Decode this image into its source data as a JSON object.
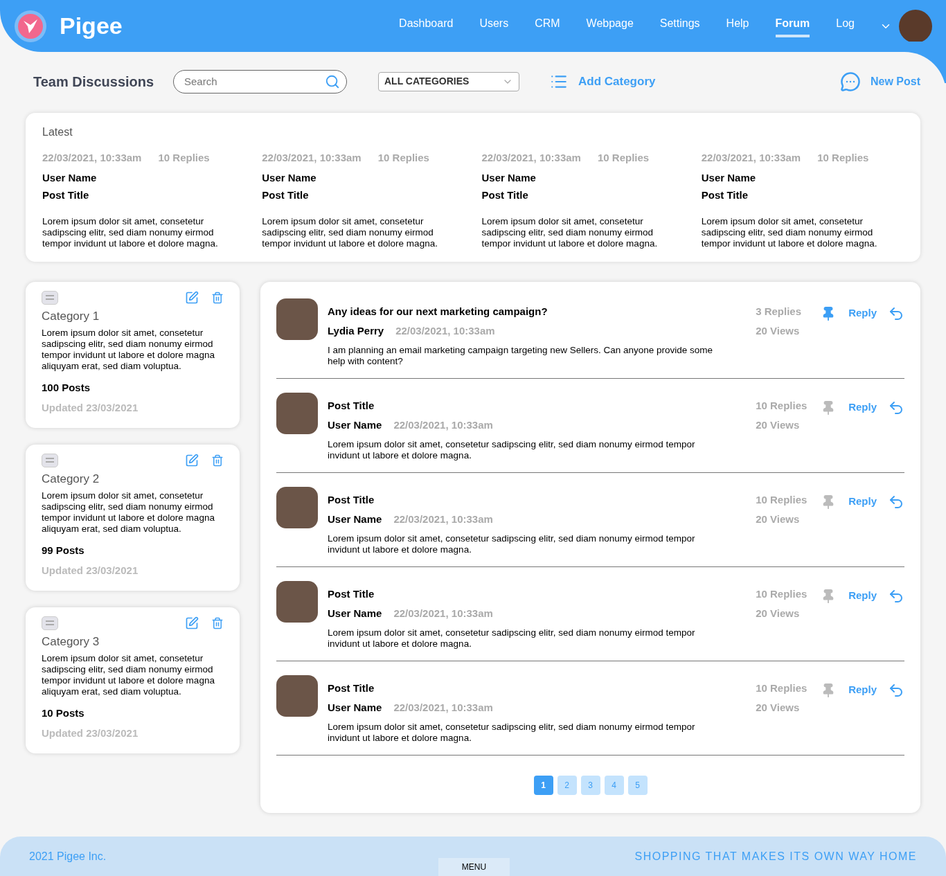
{
  "brand": "Pigee",
  "nav": [
    {
      "label": "Dashboard",
      "selected": false
    },
    {
      "label": "Users",
      "selected": false
    },
    {
      "label": "CRM",
      "selected": false
    },
    {
      "label": "Webpage",
      "selected": false
    },
    {
      "label": "Settings",
      "selected": false
    },
    {
      "label": "Help",
      "selected": false
    },
    {
      "label": "Forum",
      "selected": true
    },
    {
      "label": "Log",
      "selected": false
    }
  ],
  "page_title": "Team Discussions",
  "search": {
    "placeholder": "Search"
  },
  "category_select": {
    "value": "ALL CATEGORIES"
  },
  "add_category": "Add Category",
  "new_post": "New Post",
  "latest": {
    "title": "Latest",
    "items": [
      {
        "date": "22/03/2021, 10:33am",
        "replies": "10 Replies",
        "user": "User Name",
        "post_title": "Post Title",
        "excerpt": "Lorem ipsum dolor sit amet, consetetur sadipscing elitr, sed diam nonumy eirmod tempor invidunt ut labore et dolore magna."
      },
      {
        "date": "22/03/2021, 10:33am",
        "replies": "10 Replies",
        "user": "User Name",
        "post_title": "Post Title",
        "excerpt": "Lorem ipsum dolor sit amet, consetetur sadipscing elitr, sed diam nonumy eirmod tempor invidunt ut labore et dolore magna."
      },
      {
        "date": "22/03/2021, 10:33am",
        "replies": "10 Replies",
        "user": "User Name",
        "post_title": "Post Title",
        "excerpt": "Lorem ipsum dolor sit amet, consetetur sadipscing elitr, sed diam nonumy eirmod tempor invidunt ut labore et dolore magna."
      },
      {
        "date": "22/03/2021, 10:33am",
        "replies": "10 Replies",
        "user": "User Name",
        "post_title": "Post Title",
        "excerpt": "Lorem ipsum dolor sit amet, consetetur sadipscing elitr, sed diam nonumy eirmod tempor invidunt ut labore et dolore magna."
      }
    ]
  },
  "categories": [
    {
      "name": "Category 1",
      "description": "Lorem ipsum dolor sit amet, consetetur sadipscing elitr, sed diam nonumy eirmod tempor invidunt ut labore et dolore magna aliquyam erat, sed diam voluptua.",
      "posts": "100 Posts",
      "updated": "Updated 23/03/2021"
    },
    {
      "name": "Category 2",
      "description": "Lorem ipsum dolor sit amet, consetetur sadipscing elitr, sed diam nonumy eirmod tempor invidunt ut labore et dolore magna aliquyam erat, sed diam voluptua.",
      "posts": "99 Posts",
      "updated": "Updated 23/03/2021"
    },
    {
      "name": "Category 3",
      "description": "Lorem ipsum dolor sit amet, consetetur sadipscing elitr, sed diam nonumy eirmod tempor invidunt ut labore et dolore magna aliquyam erat, sed diam voluptua.",
      "posts": "10 Posts",
      "updated": "Updated 23/03/2021"
    }
  ],
  "posts": [
    {
      "title": "Any ideas for our next marketing campaign?",
      "user": "Lydia Perry",
      "date": "22/03/2021, 10:33am",
      "body": "I am planning an email marketing campaign targeting new Sellers. Can anyone provide some help with content?",
      "replies": "3 Replies",
      "views": "20 Views",
      "pinned": true,
      "reply": "Reply"
    },
    {
      "title": "Post Title",
      "user": "User Name",
      "date": "22/03/2021, 10:33am",
      "body": "Lorem ipsum dolor sit amet, consetetur sadipscing elitr, sed diam nonumy eirmod tempor invidunt ut labore et dolore magna.",
      "replies": "10 Replies",
      "views": "20 Views",
      "pinned": false,
      "reply": "Reply"
    },
    {
      "title": "Post Title",
      "user": "User Name",
      "date": "22/03/2021, 10:33am",
      "body": "Lorem ipsum dolor sit amet, consetetur sadipscing elitr, sed diam nonumy eirmod tempor invidunt ut labore et dolore magna.",
      "replies": "10 Replies",
      "views": "20 Views",
      "pinned": false,
      "reply": "Reply"
    },
    {
      "title": "Post Title",
      "user": "User Name",
      "date": "22/03/2021, 10:33am",
      "body": "Lorem ipsum dolor sit amet, consetetur sadipscing elitr, sed diam nonumy eirmod tempor invidunt ut labore et dolore magna.",
      "replies": "10 Replies",
      "views": "20 Views",
      "pinned": false,
      "reply": "Reply"
    },
    {
      "title": "Post Title",
      "user": "User Name",
      "date": "22/03/2021, 10:33am",
      "body": "Lorem ipsum dolor sit amet, consetetur sadipscing elitr, sed diam nonumy eirmod tempor invidunt ut labore et dolore magna.",
      "replies": "10 Replies",
      "views": "20 Views",
      "pinned": false,
      "reply": "Reply"
    }
  ],
  "pagination": [
    {
      "label": "1",
      "selected": true
    },
    {
      "label": "2",
      "selected": false
    },
    {
      "label": "3",
      "selected": false
    },
    {
      "label": "4",
      "selected": false
    },
    {
      "label": "5",
      "selected": false
    }
  ],
  "footer": {
    "copyright": "2021 Pigee Inc.",
    "menu": "MENU",
    "tagline": "SHOPPING THAT MAKES ITS OWN WAY HOME"
  }
}
